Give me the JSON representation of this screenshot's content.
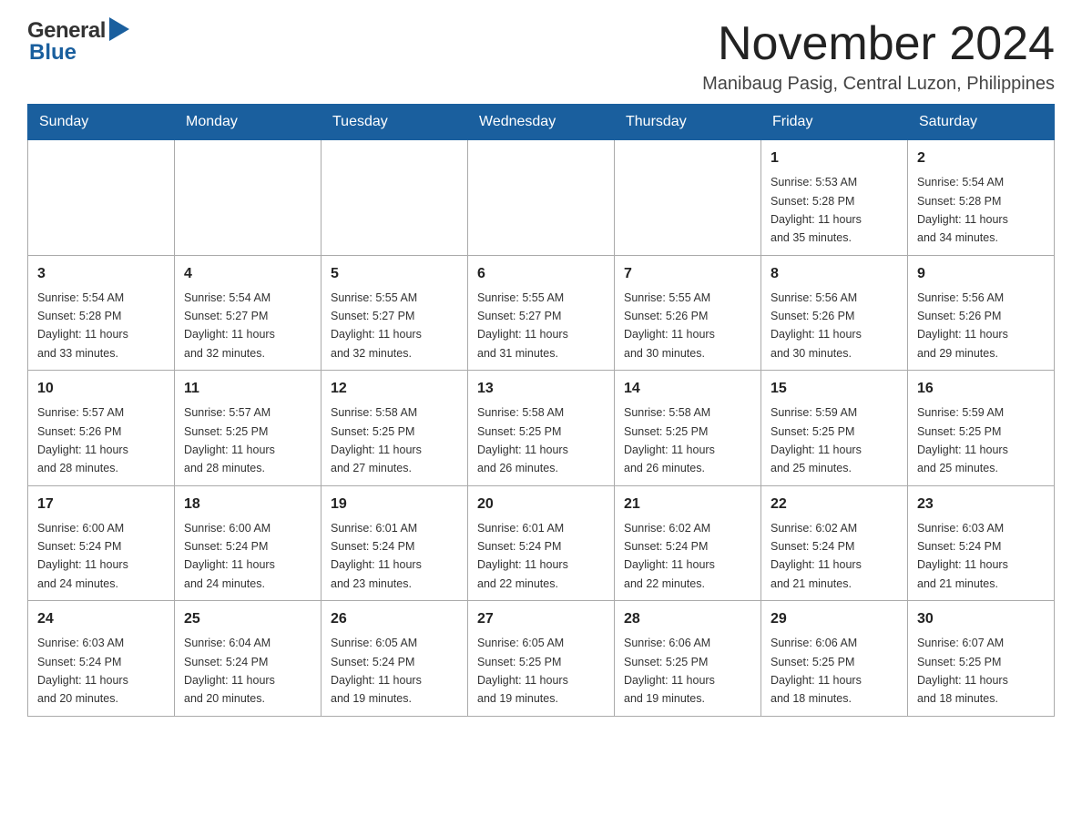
{
  "header": {
    "logo": {
      "general": "General",
      "blue": "Blue"
    },
    "title": "November 2024",
    "location": "Manibaug Pasig, Central Luzon, Philippines"
  },
  "calendar": {
    "days_of_week": [
      "Sunday",
      "Monday",
      "Tuesday",
      "Wednesday",
      "Thursday",
      "Friday",
      "Saturday"
    ],
    "weeks": [
      [
        {
          "day": "",
          "info": ""
        },
        {
          "day": "",
          "info": ""
        },
        {
          "day": "",
          "info": ""
        },
        {
          "day": "",
          "info": ""
        },
        {
          "day": "",
          "info": ""
        },
        {
          "day": "1",
          "info": "Sunrise: 5:53 AM\nSunset: 5:28 PM\nDaylight: 11 hours\nand 35 minutes."
        },
        {
          "day": "2",
          "info": "Sunrise: 5:54 AM\nSunset: 5:28 PM\nDaylight: 11 hours\nand 34 minutes."
        }
      ],
      [
        {
          "day": "3",
          "info": "Sunrise: 5:54 AM\nSunset: 5:28 PM\nDaylight: 11 hours\nand 33 minutes."
        },
        {
          "day": "4",
          "info": "Sunrise: 5:54 AM\nSunset: 5:27 PM\nDaylight: 11 hours\nand 32 minutes."
        },
        {
          "day": "5",
          "info": "Sunrise: 5:55 AM\nSunset: 5:27 PM\nDaylight: 11 hours\nand 32 minutes."
        },
        {
          "day": "6",
          "info": "Sunrise: 5:55 AM\nSunset: 5:27 PM\nDaylight: 11 hours\nand 31 minutes."
        },
        {
          "day": "7",
          "info": "Sunrise: 5:55 AM\nSunset: 5:26 PM\nDaylight: 11 hours\nand 30 minutes."
        },
        {
          "day": "8",
          "info": "Sunrise: 5:56 AM\nSunset: 5:26 PM\nDaylight: 11 hours\nand 30 minutes."
        },
        {
          "day": "9",
          "info": "Sunrise: 5:56 AM\nSunset: 5:26 PM\nDaylight: 11 hours\nand 29 minutes."
        }
      ],
      [
        {
          "day": "10",
          "info": "Sunrise: 5:57 AM\nSunset: 5:26 PM\nDaylight: 11 hours\nand 28 minutes."
        },
        {
          "day": "11",
          "info": "Sunrise: 5:57 AM\nSunset: 5:25 PM\nDaylight: 11 hours\nand 28 minutes."
        },
        {
          "day": "12",
          "info": "Sunrise: 5:58 AM\nSunset: 5:25 PM\nDaylight: 11 hours\nand 27 minutes."
        },
        {
          "day": "13",
          "info": "Sunrise: 5:58 AM\nSunset: 5:25 PM\nDaylight: 11 hours\nand 26 minutes."
        },
        {
          "day": "14",
          "info": "Sunrise: 5:58 AM\nSunset: 5:25 PM\nDaylight: 11 hours\nand 26 minutes."
        },
        {
          "day": "15",
          "info": "Sunrise: 5:59 AM\nSunset: 5:25 PM\nDaylight: 11 hours\nand 25 minutes."
        },
        {
          "day": "16",
          "info": "Sunrise: 5:59 AM\nSunset: 5:25 PM\nDaylight: 11 hours\nand 25 minutes."
        }
      ],
      [
        {
          "day": "17",
          "info": "Sunrise: 6:00 AM\nSunset: 5:24 PM\nDaylight: 11 hours\nand 24 minutes."
        },
        {
          "day": "18",
          "info": "Sunrise: 6:00 AM\nSunset: 5:24 PM\nDaylight: 11 hours\nand 24 minutes."
        },
        {
          "day": "19",
          "info": "Sunrise: 6:01 AM\nSunset: 5:24 PM\nDaylight: 11 hours\nand 23 minutes."
        },
        {
          "day": "20",
          "info": "Sunrise: 6:01 AM\nSunset: 5:24 PM\nDaylight: 11 hours\nand 22 minutes."
        },
        {
          "day": "21",
          "info": "Sunrise: 6:02 AM\nSunset: 5:24 PM\nDaylight: 11 hours\nand 22 minutes."
        },
        {
          "day": "22",
          "info": "Sunrise: 6:02 AM\nSunset: 5:24 PM\nDaylight: 11 hours\nand 21 minutes."
        },
        {
          "day": "23",
          "info": "Sunrise: 6:03 AM\nSunset: 5:24 PM\nDaylight: 11 hours\nand 21 minutes."
        }
      ],
      [
        {
          "day": "24",
          "info": "Sunrise: 6:03 AM\nSunset: 5:24 PM\nDaylight: 11 hours\nand 20 minutes."
        },
        {
          "day": "25",
          "info": "Sunrise: 6:04 AM\nSunset: 5:24 PM\nDaylight: 11 hours\nand 20 minutes."
        },
        {
          "day": "26",
          "info": "Sunrise: 6:05 AM\nSunset: 5:24 PM\nDaylight: 11 hours\nand 19 minutes."
        },
        {
          "day": "27",
          "info": "Sunrise: 6:05 AM\nSunset: 5:25 PM\nDaylight: 11 hours\nand 19 minutes."
        },
        {
          "day": "28",
          "info": "Sunrise: 6:06 AM\nSunset: 5:25 PM\nDaylight: 11 hours\nand 19 minutes."
        },
        {
          "day": "29",
          "info": "Sunrise: 6:06 AM\nSunset: 5:25 PM\nDaylight: 11 hours\nand 18 minutes."
        },
        {
          "day": "30",
          "info": "Sunrise: 6:07 AM\nSunset: 5:25 PM\nDaylight: 11 hours\nand 18 minutes."
        }
      ]
    ]
  }
}
